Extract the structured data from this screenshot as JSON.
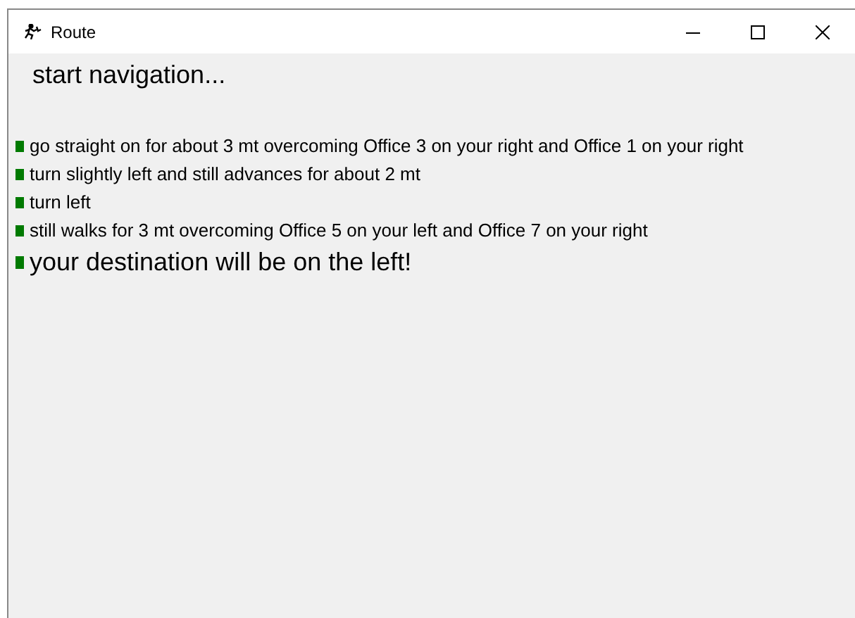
{
  "window": {
    "title": "Route"
  },
  "heading": "start navigation...",
  "steps": [
    {
      "kind": "step",
      "text": "go straight on for about 3 mt overcoming Office 3 on your right and Office 1 on your right"
    },
    {
      "kind": "step",
      "text": "turn slightly left and still advances for about 2 mt"
    },
    {
      "kind": "step",
      "text": "turn left"
    },
    {
      "kind": "step",
      "text": "still walks for 3 mt overcoming Office 5 on your left and Office 7 on your right"
    },
    {
      "kind": "final",
      "text": "your destination will be on the left!"
    }
  ]
}
